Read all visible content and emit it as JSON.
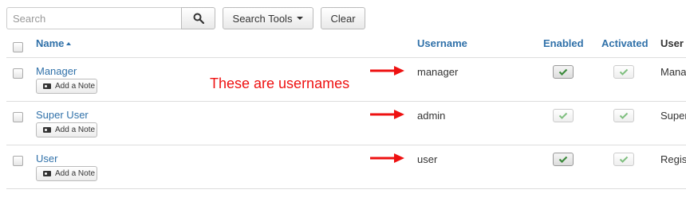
{
  "toolbar": {
    "search_placeholder": "Search",
    "search_tools_label": "Search Tools",
    "clear_label": "Clear"
  },
  "table": {
    "headers": {
      "name": "Name",
      "username": "Username",
      "enabled": "Enabled",
      "activated": "Activated",
      "group": "User"
    },
    "rows": [
      {
        "name": "Manager",
        "note_label": "Add a Note",
        "username": "manager",
        "enabled": true,
        "activated": true,
        "group": "Manager"
      },
      {
        "name": "Super User",
        "note_label": "Add a Note",
        "username": "admin",
        "enabled": true,
        "activated": true,
        "group": "Super Users"
      },
      {
        "name": "User",
        "note_label": "Add a Note",
        "username": "user",
        "enabled": true,
        "activated": true,
        "group": "Registered"
      }
    ]
  },
  "annotation": {
    "text": "These are usernames",
    "color": "#ee1111"
  },
  "colors": {
    "link": "#3071a9",
    "check": "#3c8a3c"
  }
}
